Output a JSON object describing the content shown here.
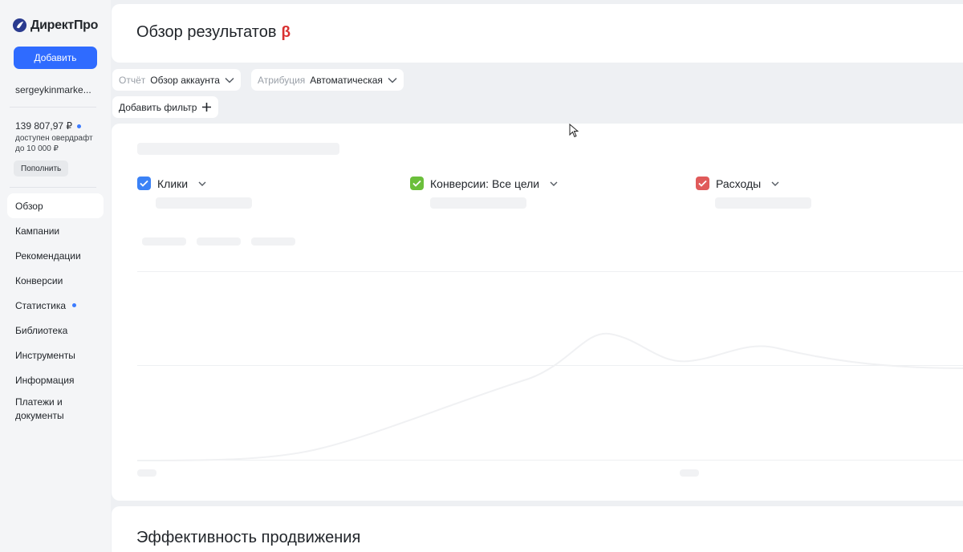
{
  "sidebar": {
    "logo_text": "ДиректПро",
    "add_button": "Добавить",
    "login": "sergeykinmarke...",
    "balance": "139 807,97 ₽",
    "overdraft": "доступен овердрафт до 10 000 ₽",
    "topup_button": "Пополнить",
    "nav": [
      {
        "label": "Обзор",
        "active": true
      },
      {
        "label": "Кампании"
      },
      {
        "label": "Рекомендации"
      },
      {
        "label": "Конверсии"
      },
      {
        "label": "Статистика",
        "dot": true
      },
      {
        "label": "Библиотека"
      },
      {
        "label": "Инструменты"
      },
      {
        "label": "Информация"
      },
      {
        "label": "Платежи и документы"
      }
    ]
  },
  "header": {
    "title": "Обзор результатов",
    "beta": "β"
  },
  "filters": {
    "report_label": "Отчёт",
    "report_value": "Обзор аккаунта",
    "attribution_label": "Атрибуция",
    "attribution_value": "Автоматическая",
    "add_filter": "Добавить фильтр"
  },
  "metrics": [
    {
      "label": "Клики",
      "color": "#3b82f6"
    },
    {
      "label": "Конверсии: Все цели",
      "color": "#6bbf3b"
    },
    {
      "label": "Расходы",
      "color": "#e05a5a"
    }
  ],
  "section": {
    "title": "Эффективность продвижения"
  },
  "colors": {
    "accent": "#2f6bff",
    "beta": "#d93131"
  }
}
